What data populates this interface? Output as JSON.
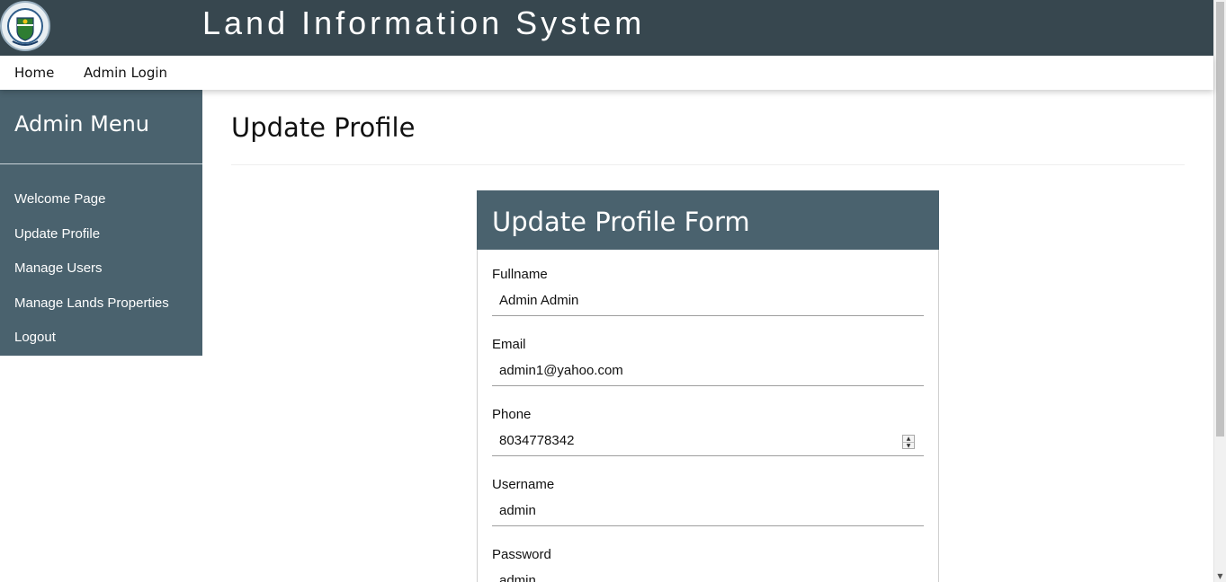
{
  "header": {
    "title": "Land Information System",
    "logo_icon": "state-seal-logo"
  },
  "topnav": {
    "home": "Home",
    "admin_login": "Admin Login"
  },
  "sidebar": {
    "title": "Admin Menu",
    "items": [
      {
        "label": "Welcome Page"
      },
      {
        "label": "Update Profile"
      },
      {
        "label": "Manage Users"
      },
      {
        "label": "Manage Lands Properties"
      },
      {
        "label": "Logout"
      }
    ]
  },
  "main": {
    "page_title": "Update Profile"
  },
  "form": {
    "title": "Update Profile Form",
    "fields": [
      {
        "label": "Fullname",
        "value": "Admin Admin"
      },
      {
        "label": "Email",
        "value": "admin1@yahoo.com"
      },
      {
        "label": "Phone",
        "value": "8034778342"
      },
      {
        "label": "Username",
        "value": "admin"
      },
      {
        "label": "Password",
        "value": "admin"
      }
    ]
  },
  "colors": {
    "header_bg": "#37474f",
    "sidebar_bg": "#4a626e",
    "card_header_bg": "#4a626e"
  }
}
